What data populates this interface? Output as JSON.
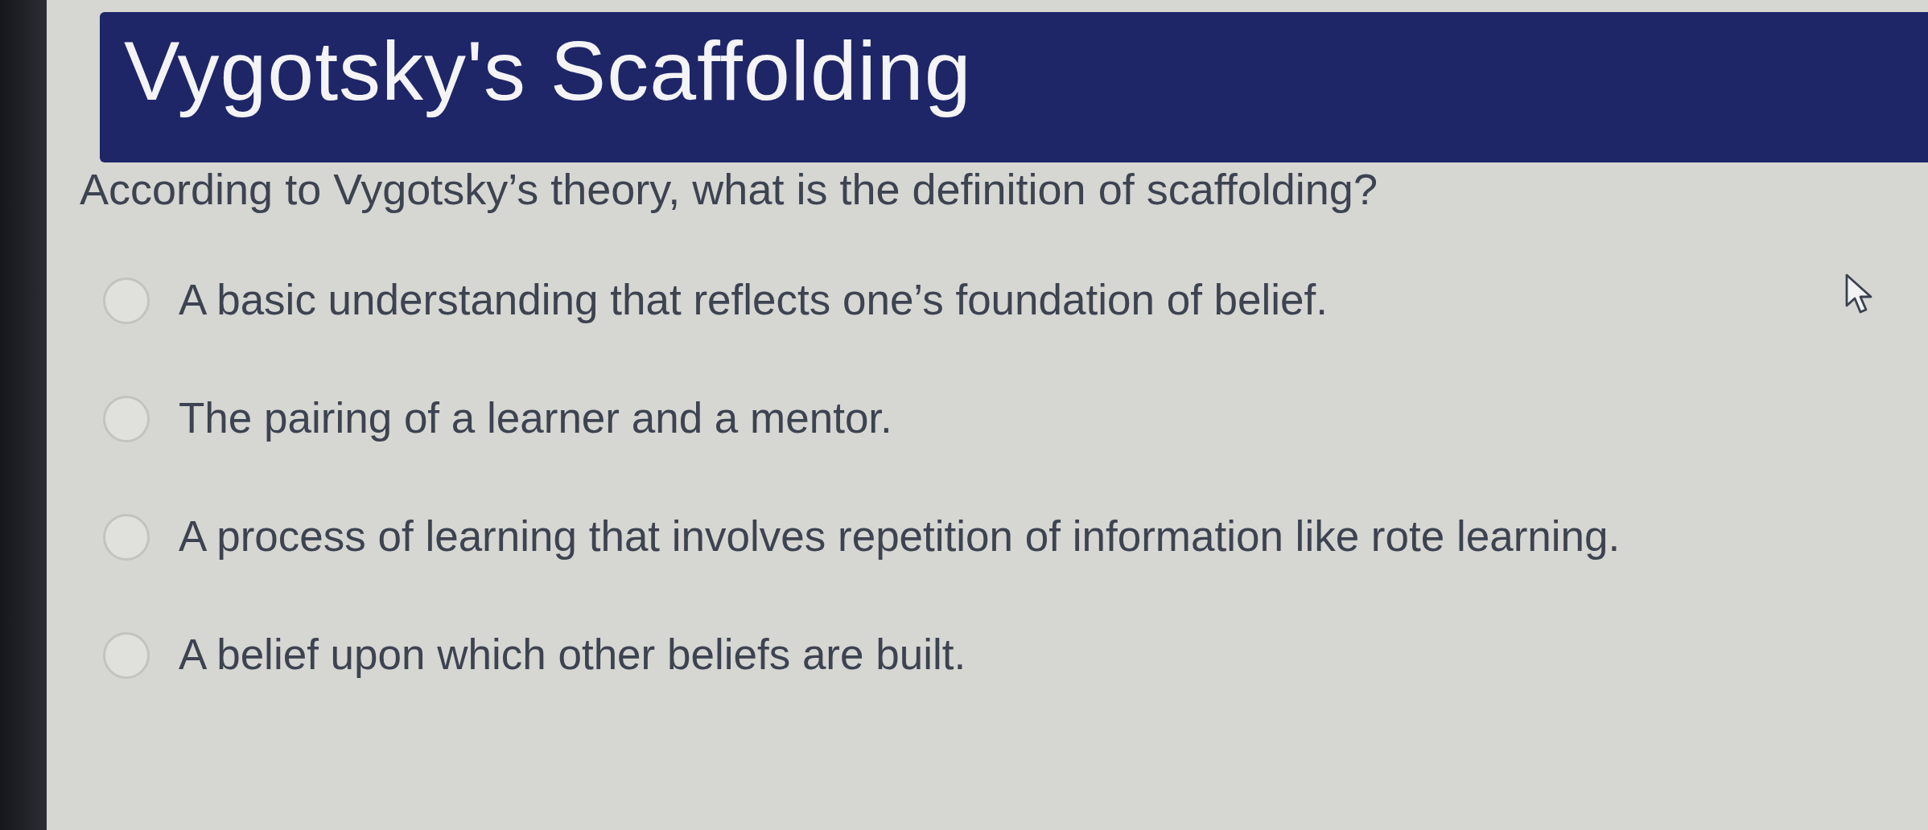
{
  "header": {
    "title": "Vygotsky's Scaffolding"
  },
  "question": {
    "text": "According to Vygotsky’s theory, what is the definition of scaffolding?"
  },
  "options": [
    {
      "label": "A basic understanding that reflects one’s foundation of belief.",
      "selected": false
    },
    {
      "label": "The pairing of a learner and a mentor.",
      "selected": false
    },
    {
      "label": "A process of learning that involves repetition of information like rote learning.",
      "selected": false
    },
    {
      "label": "A belief upon which other beliefs are built.",
      "selected": false
    }
  ]
}
